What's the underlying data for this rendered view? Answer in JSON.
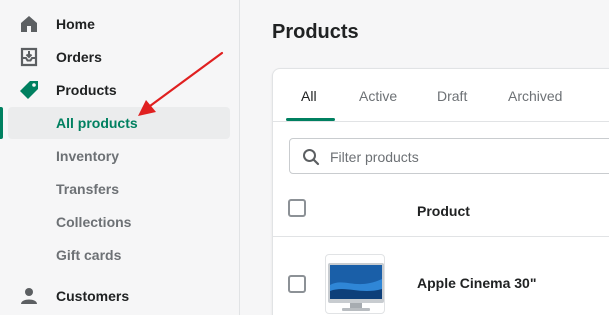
{
  "sidebar": {
    "items": [
      {
        "label": "Home",
        "icon": "home-icon"
      },
      {
        "label": "Orders",
        "icon": "orders-icon"
      },
      {
        "label": "Products",
        "icon": "tag-icon"
      },
      {
        "label": "Customers",
        "icon": "person-icon"
      }
    ],
    "subitems": [
      {
        "label": "All products",
        "active": true
      },
      {
        "label": "Inventory"
      },
      {
        "label": "Transfers"
      },
      {
        "label": "Collections"
      },
      {
        "label": "Gift cards"
      }
    ]
  },
  "main": {
    "title": "Products",
    "tabs": [
      "All",
      "Active",
      "Draft",
      "Archived"
    ],
    "search_placeholder": "Filter products",
    "column_header": "Product",
    "rows": [
      {
        "name": "Apple Cinema 30\""
      }
    ]
  },
  "colors": {
    "accent": "#008060",
    "annotation_arrow": "#e02020"
  }
}
